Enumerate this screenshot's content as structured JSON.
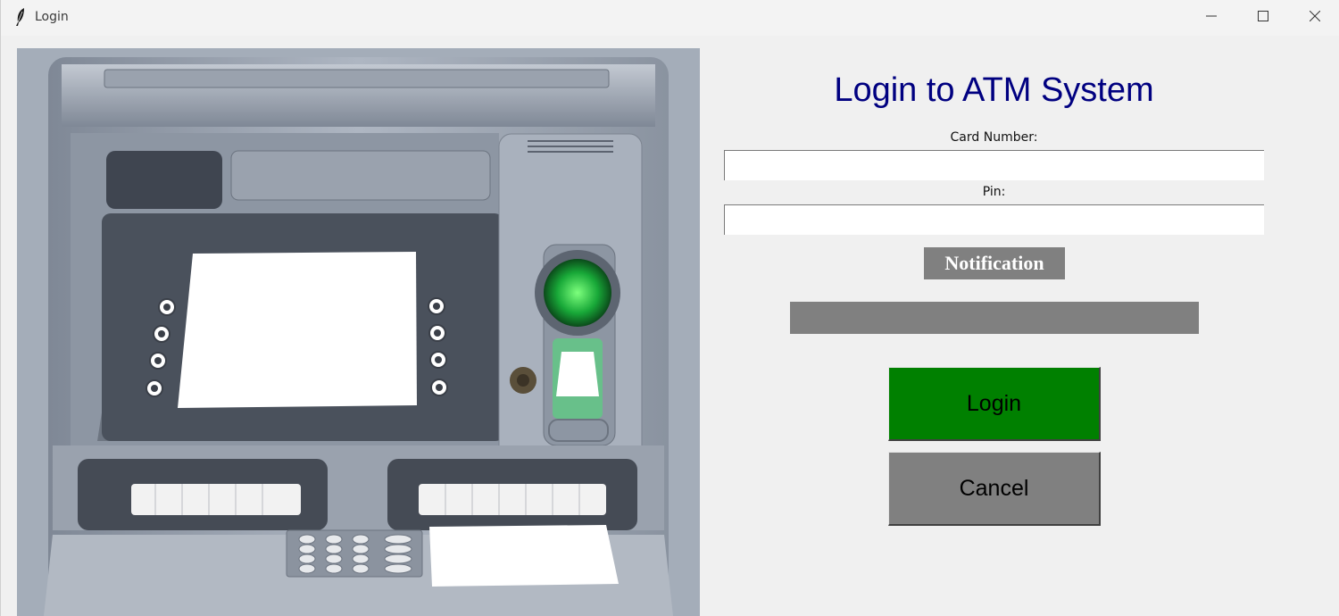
{
  "window": {
    "title": "Login",
    "icon": "feather-icon",
    "controls": [
      "minimize-icon",
      "maximize-icon",
      "close-icon"
    ]
  },
  "image": {
    "description_icon": "atm-machine-image"
  },
  "form": {
    "title": "Login to ATM System",
    "card_label": "Card Number:",
    "card_value": "",
    "pin_label": "Pin:",
    "pin_value": "",
    "notification_label": "Notification",
    "notification_text": "",
    "login_label": "Login",
    "cancel_label": "Cancel"
  },
  "colors": {
    "title": "#000080",
    "login_button": "#008000",
    "cancel_button": "#808080",
    "notification": "#808080"
  }
}
